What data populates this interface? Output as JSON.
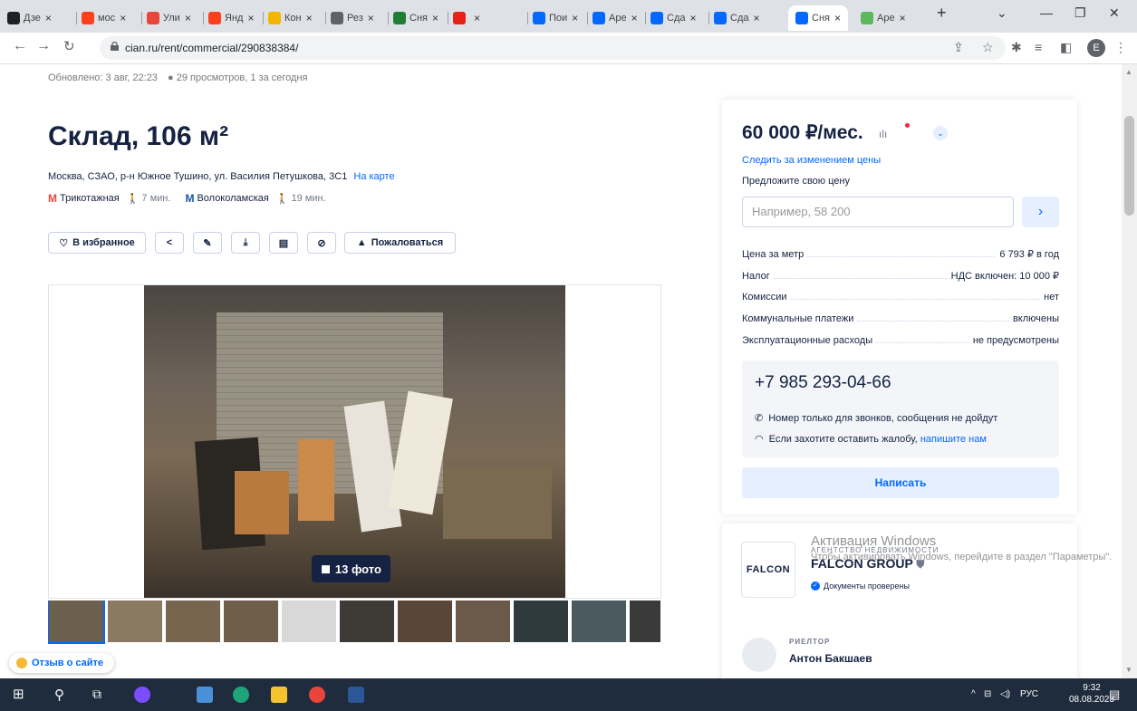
{
  "browser": {
    "tabs": [
      {
        "label": "Дзе",
        "color": "#202124"
      },
      {
        "label": "мос",
        "color": "#fc3f1d"
      },
      {
        "label": "Ули",
        "color": "#e8453c"
      },
      {
        "label": "Янд",
        "color": "#fc3f1d"
      },
      {
        "label": "Кон",
        "color": "#f4b400"
      },
      {
        "label": "Рез",
        "color": "#5f6368"
      },
      {
        "label": "Сня",
        "color": "#1e7e34"
      },
      {
        "label": "",
        "color": "#e62117"
      },
      {
        "label": "Пои",
        "color": "#0468ff"
      },
      {
        "label": "Аре",
        "color": "#0468ff"
      },
      {
        "label": "Сда",
        "color": "#0468ff"
      },
      {
        "label": "Сда",
        "color": "#0468ff"
      },
      {
        "label": "Сня",
        "color": "#0468ff"
      },
      {
        "label": "Аре",
        "color": "#5cb85c"
      }
    ],
    "url": "cian.ru/rent/commercial/290838384/",
    "profile_initial": "E"
  },
  "listing": {
    "updated": "Обновлено: 3 авг, 22:23",
    "views": "29 просмотров, 1 за сегодня",
    "title": "Склад, 106 м²",
    "address": "Москва, СЗАО, р-н Южное Тушино, ул. Василия Петушкова, 3С1",
    "map_link": "На карте",
    "metro": [
      {
        "name": "Трикотажная",
        "time": "7 мин.",
        "color": "#e8453c"
      },
      {
        "name": "Волоколамская",
        "time": "19 мин.",
        "color": "#1a56a8"
      }
    ],
    "actions": {
      "favorite": "В избранное",
      "report": "Пожаловаться"
    },
    "photo_count": "13 фото",
    "feedback": "Отзыв о сайте"
  },
  "price_card": {
    "price": "60 000 ₽/мес.",
    "follow": "Следить за изменением цены",
    "offer_label": "Предложите свою цену",
    "offer_placeholder": "Например, 58 200",
    "rows": [
      {
        "label": "Цена за метр",
        "value": "6 793 ₽ в год"
      },
      {
        "label": "Налог",
        "value": "НДС включен: 10 000 ₽"
      },
      {
        "label": "Комиссии",
        "value": "нет"
      },
      {
        "label": "Коммунальные платежи",
        "value": "включены"
      },
      {
        "label": "Эксплуатационные расходы",
        "value": "не предусмотрены"
      }
    ],
    "phone": "+7 985 293-04-66",
    "note_calls": "Номер только для звонков, сообщения не дойдут",
    "note_complaint": "Если захотите оставить жалобу,",
    "note_complaint_link": "напишите нам",
    "write_button": "Написать"
  },
  "agency": {
    "logo_text": "FALCON",
    "label": "АГЕНТСТВО НЕДВИЖИМОСТИ",
    "name": "FALCON GROUP",
    "verified": "Документы проверены",
    "realtor_label": "РИЕЛТОР",
    "realtor_name": "Антон Бакшаев"
  },
  "windows_watermark": {
    "title": "Активация Windows",
    "subtitle": "Чтобы активировать Windows, перейдите в раздел \"Параметры\"."
  },
  "taskbar": {
    "lang": "РУС",
    "time": "9:32",
    "date": "08.08.2023"
  }
}
